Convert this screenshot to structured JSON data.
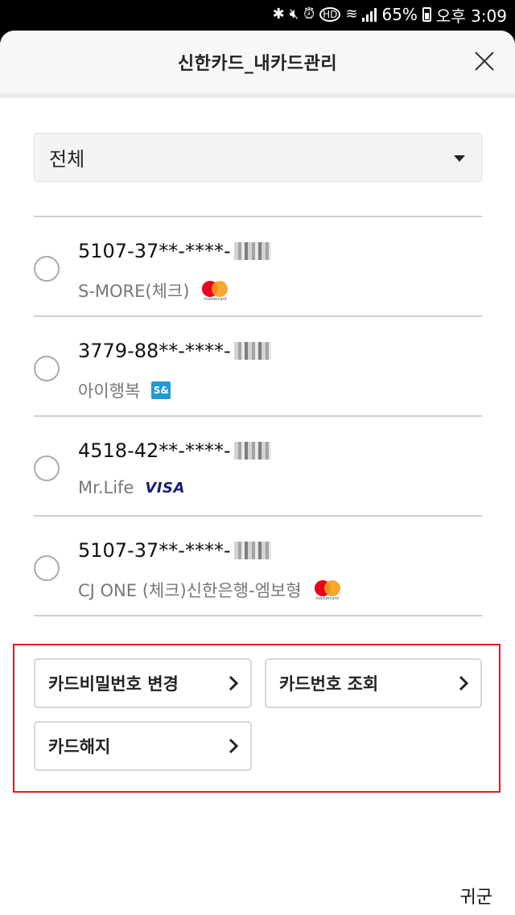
{
  "status_bar": {
    "battery": "65%",
    "time": "오후 3:09",
    "icons": [
      "bluetooth-icon",
      "mute-icon",
      "alarm-icon",
      "hd-icon",
      "wifi-icon",
      "signal-icon",
      "battery-icon"
    ]
  },
  "header": {
    "title": "신한카드_내카드관리",
    "close_icon": "close-icon"
  },
  "filter": {
    "selected": "전체"
  },
  "cards": [
    {
      "number": "5107-37**-****-",
      "name": "S-MORE(체크)",
      "brand": "mastercard",
      "brand_label": "mastercard"
    },
    {
      "number": "3779-88**-****-",
      "name": "아이행복",
      "brand": "s-and",
      "brand_label": "S&"
    },
    {
      "number": "4518-42**-****-",
      "name": "Mr.Life",
      "brand": "visa",
      "brand_label": "VISA"
    },
    {
      "number": "5107-37**-****-",
      "name": "CJ ONE (체크)신한은행-엠보형",
      "brand": "mastercard",
      "brand_label": "mastercard"
    }
  ],
  "actions": {
    "change_pin": "카드비밀번호 변경",
    "view_number": "카드번호 조회",
    "cancel_card": "카드해지"
  },
  "colors": {
    "highlight_border": "#e01d1d",
    "divider": "#cfcfcf"
  },
  "watermark": "귀군"
}
